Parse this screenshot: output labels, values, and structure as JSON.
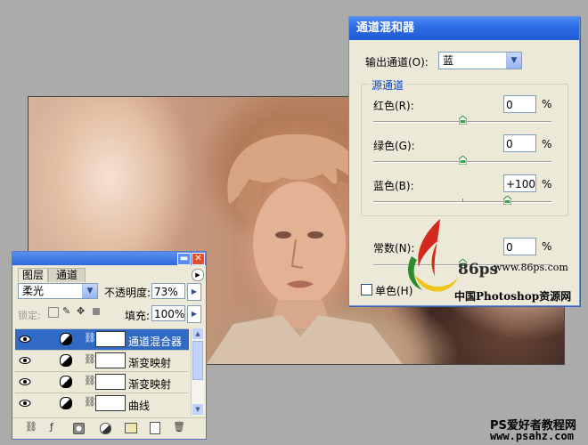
{
  "mixer": {
    "title": "通道混和器",
    "output_label": "输出通道(O):",
    "output_value": "蓝",
    "group_label": "源通道",
    "channels": [
      {
        "label": "红色(R):",
        "value": "0",
        "unit": "%",
        "level": 0
      },
      {
        "label": "绿色(G):",
        "value": "0",
        "unit": "%",
        "level": 0
      },
      {
        "label": "蓝色(B):",
        "value": "+100",
        "unit": "%",
        "level": 100
      }
    ],
    "constant_label": "常数(N):",
    "constant_value": "0",
    "constant_unit": "%",
    "monochrome_label": "单色(H)"
  },
  "layers_panel": {
    "tabs": [
      "图层",
      "通道"
    ],
    "blend_mode": "柔光",
    "opacity_label": "不透明度:",
    "opacity_value": "73%",
    "lock_label": "锁定:",
    "fill_label": "填充:",
    "fill_value": "100%",
    "rows": [
      {
        "name": "通道混合器",
        "selected": true
      },
      {
        "name": "渐变映射",
        "selected": false
      },
      {
        "name": "渐变映射",
        "selected": false
      },
      {
        "name": "曲线",
        "selected": false
      }
    ]
  },
  "watermark": {
    "logo_text": "86ps",
    "site_url": "www.86ps.com",
    "site_name": "中国Photoshop资源网",
    "footer_line1": "PS爱好者教程网",
    "footer_line2": "www.psahz.com"
  },
  "colors": {
    "titlebar": "#2d6de6",
    "dialog_bg": "#ece9d8",
    "selected_row": "#316ac5"
  }
}
